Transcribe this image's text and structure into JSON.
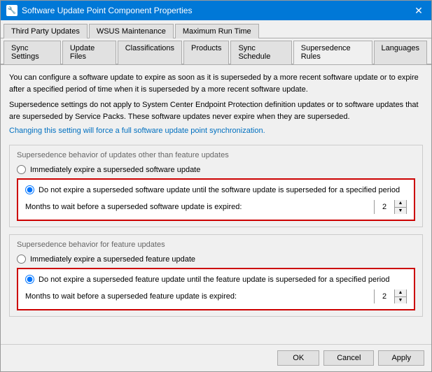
{
  "titleBar": {
    "icon": "🔧",
    "title": "Software Update Point Component Properties",
    "closeLabel": "✕"
  },
  "tabs": {
    "row1": [
      {
        "label": "Third Party Updates",
        "active": false
      },
      {
        "label": "WSUS Maintenance",
        "active": false
      },
      {
        "label": "Maximum Run Time",
        "active": false
      }
    ],
    "row2": [
      {
        "label": "Sync Settings",
        "active": false
      },
      {
        "label": "Update Files",
        "active": false
      },
      {
        "label": "Classifications",
        "active": false
      },
      {
        "label": "Products",
        "active": false
      },
      {
        "label": "Sync Schedule",
        "active": false
      },
      {
        "label": "Supersedence Rules",
        "active": true
      },
      {
        "label": "Languages",
        "active": false
      }
    ]
  },
  "content": {
    "desc1": "You can configure a software update to expire as soon as it is superseded by a more recent software update or to expire after a specified period of time when it is superseded by a more recent software update.",
    "desc2": "Supersedence settings do not apply to System Center Endpoint Protection definition updates or to software updates that are superseded by Service Packs. These software updates never expire when they are superseded.",
    "desc3": "Changing this setting will force a full software update point synchronization.",
    "section1": {
      "title": "Supersedence behavior of updates other than feature updates",
      "radio1": {
        "label": "Immediately expire a superseded software update",
        "checked": false
      },
      "radio2": {
        "label": "Do not expire a superseded software update until the software update is superseded for a specified period",
        "checked": true
      },
      "monthsLabel": "Months to wait before a superseded software update is expired:",
      "monthsValue": "2"
    },
    "section2": {
      "title": "Supersedence behavior for feature updates",
      "radio1": {
        "label": "Immediately expire a superseded feature update",
        "checked": false
      },
      "radio2": {
        "label": "Do not expire a superseded feature update until the feature update is superseded for a specified period",
        "checked": true
      },
      "monthsLabel": "Months to wait before a superseded feature update is expired:",
      "monthsValue": "2"
    }
  },
  "buttons": {
    "ok": "OK",
    "cancel": "Cancel",
    "apply": "Apply"
  }
}
